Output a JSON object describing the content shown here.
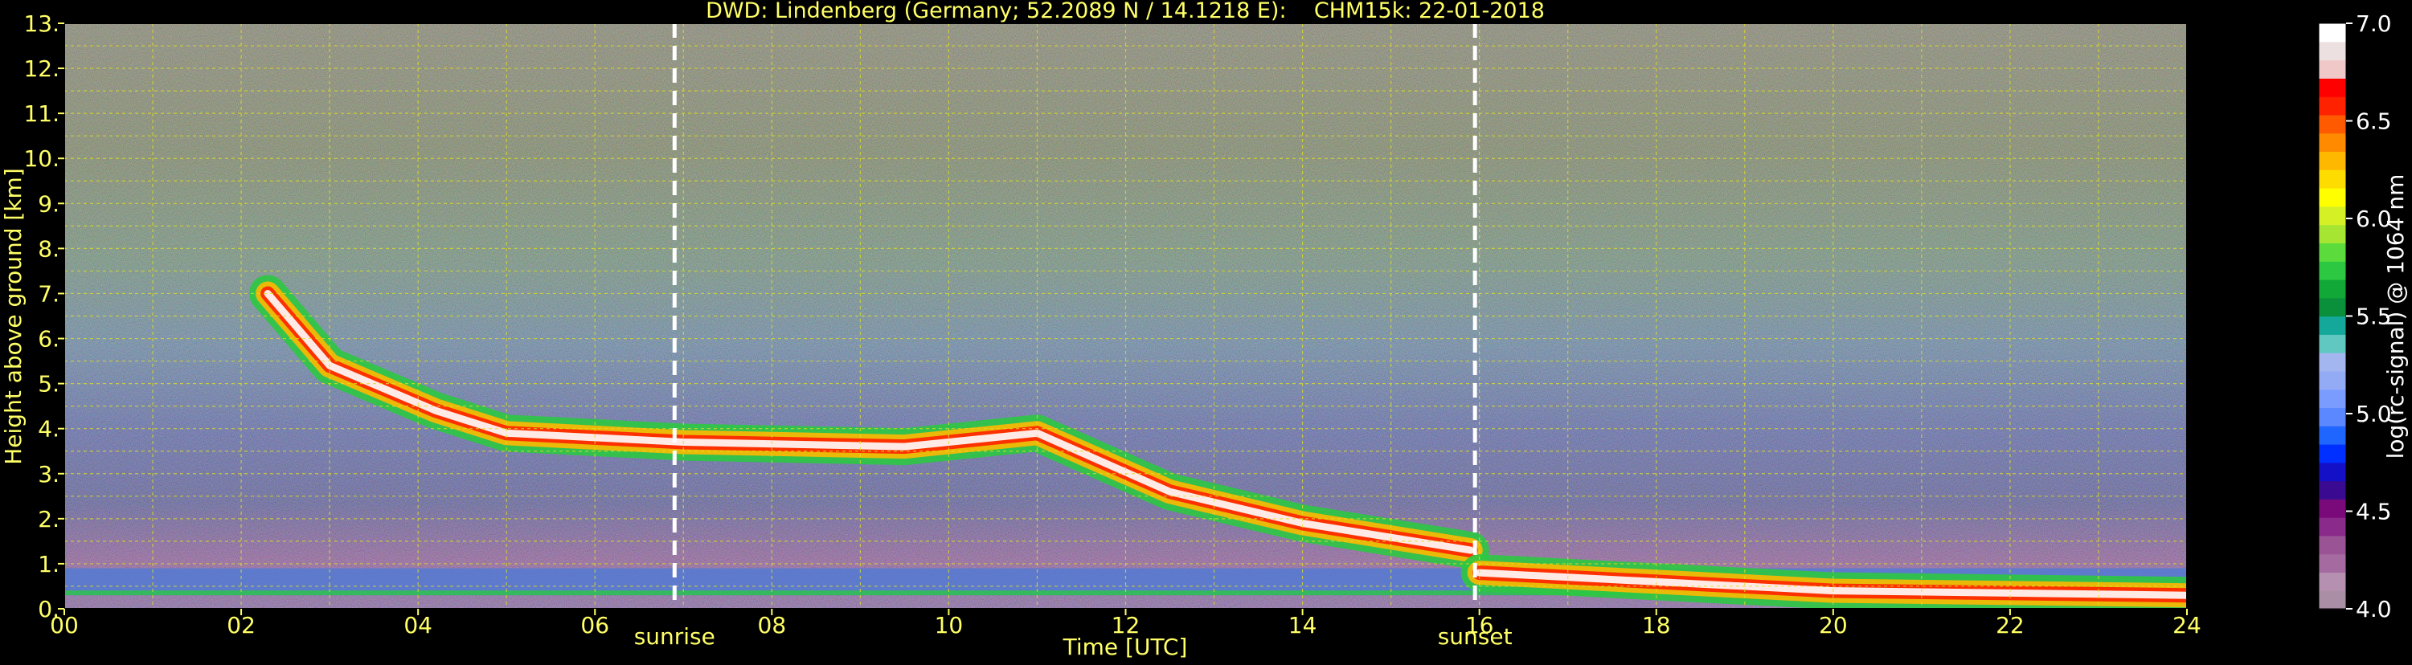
{
  "chart_data": {
    "type": "heatmap",
    "title": "DWD: Lindenberg (Germany; 52.2089 N / 14.1218 E):    CHM15k: 22-01-2018",
    "xlabel": "Time [UTC]",
    "ylabel": "Height above ground [km]",
    "xlim": [
      0,
      24
    ],
    "ylim": [
      0,
      13
    ],
    "x_ticks": [
      "00",
      "02",
      "04",
      "06",
      "08",
      "10",
      "12",
      "14",
      "16",
      "18",
      "20",
      "22",
      "24"
    ],
    "y_ticks": [
      "0.",
      "1.",
      "2.",
      "3.",
      "4.",
      "5.",
      "6.",
      "7.",
      "8.",
      "9.",
      "10.",
      "11.",
      "12.",
      "13."
    ],
    "grid": true,
    "annotations": [
      {
        "label": "sunrise",
        "time_utc": 6.9
      },
      {
        "label": "sunset",
        "time_utc": 15.95
      }
    ],
    "colorbar": {
      "label": "log(rc-signal) @ 1064 nm",
      "range": [
        4.0,
        7.0
      ],
      "ticks": [
        "4.0",
        "4.5",
        "5.0",
        "5.5",
        "6.0",
        "6.5",
        "7.0"
      ],
      "colors": [
        "#a98ea5",
        "#b590b0",
        "#a56aa0",
        "#9a5496",
        "#8a2a8a",
        "#7a0a7a",
        "#3a0b90",
        "#1410c8",
        "#0030ff",
        "#1f66ff",
        "#5b88ff",
        "#7a9cff",
        "#93aaf5",
        "#a4b6f0",
        "#60c8c0",
        "#14a89a",
        "#0a8f3a",
        "#12a838",
        "#2cc842",
        "#5cdc3c",
        "#a6e632",
        "#d6f026",
        "#ffff00",
        "#ffdc00",
        "#ffb800",
        "#ff8a00",
        "#ff5a00",
        "#ff2200",
        "#ff0000",
        "#f0c8c8",
        "#ece0e0",
        "#ffffff"
      ]
    },
    "features": [
      {
        "name": "boundary layer",
        "height_km": [
          0.3,
          0.9
        ],
        "time_utc": [
          0,
          24
        ]
      },
      {
        "name": "descending cloud layer",
        "points": [
          [
            2.3,
            7.0
          ],
          [
            3.0,
            5.4
          ],
          [
            4.2,
            4.4
          ],
          [
            5.0,
            3.9
          ],
          [
            6.0,
            3.8
          ],
          [
            7.0,
            3.7
          ],
          [
            9.5,
            3.6
          ],
          [
            11.0,
            3.9
          ],
          [
            12.5,
            2.6
          ],
          [
            14.0,
            1.9
          ],
          [
            15.9,
            1.3
          ]
        ]
      },
      {
        "name": "low cloud after sunset",
        "points": [
          [
            16.0,
            0.8
          ],
          [
            18.0,
            0.6
          ],
          [
            20.0,
            0.4
          ],
          [
            24.0,
            0.3
          ]
        ]
      }
    ]
  }
}
